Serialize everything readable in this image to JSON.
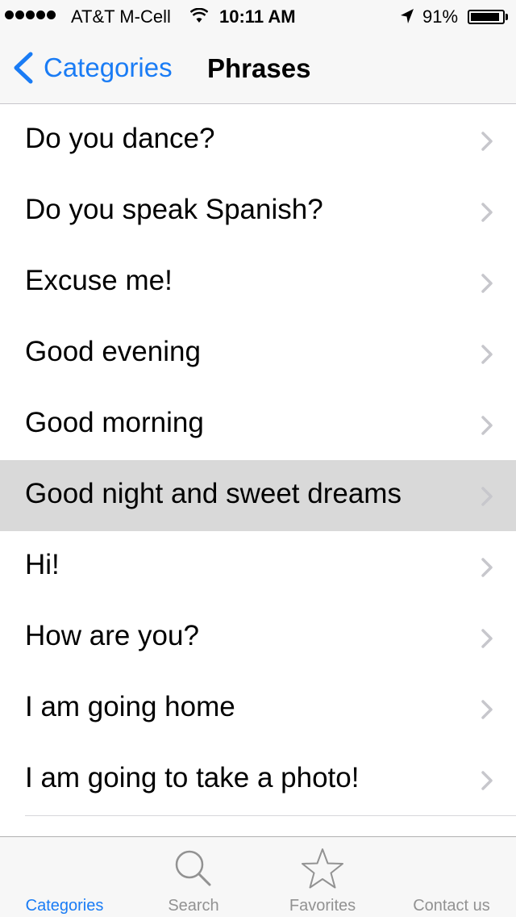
{
  "status_bar": {
    "carrier": "AT&T M-Cell",
    "time": "10:11 AM",
    "battery_percent": "91%",
    "battery_level": 0.91,
    "signal_bars": 5
  },
  "nav": {
    "back_label": "Categories",
    "title": "Phrases"
  },
  "phrases": [
    "Do you dance?",
    "Do you speak Spanish?",
    "Excuse me!",
    "Good evening",
    "Good morning",
    "Good night and sweet dreams",
    "Hi!",
    "How are you?",
    "I am going home",
    "I am going to take a photo!"
  ],
  "selected_phrase": "Good night and sweet dreams",
  "tabs": [
    {
      "label": "Categories",
      "icon": "categories-icon",
      "active": true
    },
    {
      "label": "Search",
      "icon": "search-icon",
      "active": false
    },
    {
      "label": "Favorites",
      "icon": "star-icon",
      "active": false
    },
    {
      "label": "Contact us",
      "icon": "contact-icon",
      "active": false
    }
  ],
  "colors": {
    "accent": "#1a7cf5",
    "selected_row": "#d9d9d9",
    "inactive_tab": "#929292",
    "chevron": "#c7c7cc"
  }
}
